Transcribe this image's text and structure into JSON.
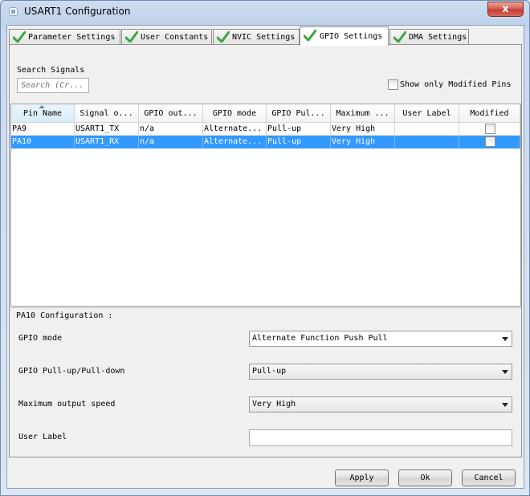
{
  "window": {
    "title": "USART1 Configuration",
    "close_glyph": "x",
    "icon": "app-icon"
  },
  "tabs": [
    {
      "label": "Parameter Settings",
      "icon": "green-check-icon",
      "active": false
    },
    {
      "label": "User Constants",
      "icon": "green-check-icon",
      "active": false
    },
    {
      "label": "NVIC Settings",
      "icon": "green-check-icon",
      "active": false
    },
    {
      "label": "GPIO Settings",
      "icon": "green-check-icon",
      "active": true
    },
    {
      "label": "DMA Settings",
      "icon": "green-check-icon",
      "active": false
    }
  ],
  "search": {
    "label": "Search Signals",
    "placeholder": "Search (Cr...",
    "value": ""
  },
  "show_modified": {
    "label": "Show only Modified Pins",
    "checked": false
  },
  "table": {
    "columns": [
      "Pin Name",
      "Signal o...",
      "GPIO out...",
      "GPIO mode",
      "GPIO Pul...",
      "Maximum ...",
      "User Label",
      "Modified"
    ],
    "sorted_column": "Pin Name",
    "rows": [
      {
        "pin": "PA9",
        "signal": "USART1_TX",
        "gpio_output": "n/a",
        "gpio_mode": "Alternate...",
        "gpio_pull": "Pull-up",
        "max_speed": "Very High",
        "user_label": "",
        "modified": false,
        "selected": false
      },
      {
        "pin": "PA10",
        "signal": "USART1_RX",
        "gpio_output": "n/a",
        "gpio_mode": "Alternate...",
        "gpio_pull": "Pull-up",
        "max_speed": "Very High",
        "user_label": "",
        "modified": false,
        "selected": true
      }
    ]
  },
  "config": {
    "title": "PA10 Configuration :",
    "gpio_mode": {
      "label": "GPIO mode",
      "value": "Alternate Function Push Pull"
    },
    "gpio_pull": {
      "label": "GPIO Pull-up/Pull-down",
      "value": "Pull-up"
    },
    "max_speed": {
      "label": "Maximum output speed",
      "value": "Very High"
    },
    "user_label": {
      "label": "User Label",
      "value": ""
    }
  },
  "buttons": {
    "apply": "Apply",
    "ok": "Ok",
    "cancel": "Cancel"
  },
  "colors": {
    "selection": "#3399ff",
    "check_green": "#3aa53a",
    "close_red": "#c94a3d"
  }
}
